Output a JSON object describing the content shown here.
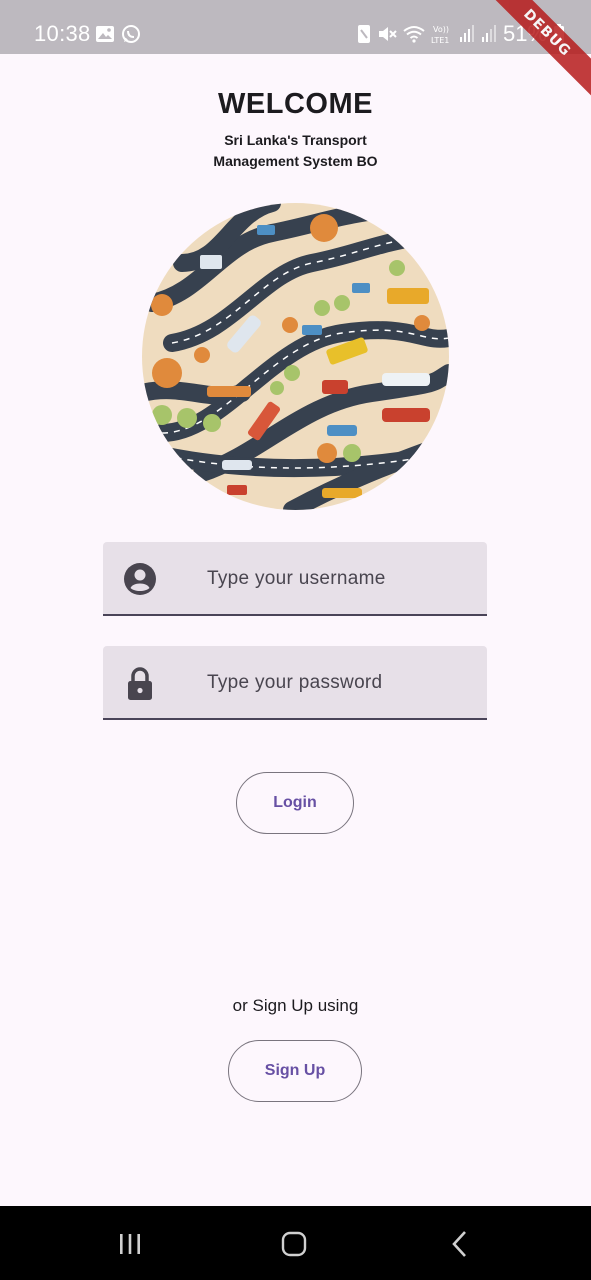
{
  "status_bar": {
    "time": "10:38",
    "battery": "51%",
    "icons": [
      "gallery-icon",
      "whatsapp-icon",
      "nfc-icon",
      "mute-icon",
      "wifi-icon",
      "volte-icon",
      "signal-icon",
      "signal-icon",
      "battery-icon"
    ]
  },
  "debug_banner": "DEBUG",
  "header": {
    "title": "WELCOME",
    "subtitle_line1": "Sri Lanka's Transport",
    "subtitle_line2": "Management System BO"
  },
  "illustration": {
    "description_icon": "transport-map-illustration"
  },
  "form": {
    "username_placeholder": "Type your username",
    "username_value": "",
    "password_placeholder": "Type your password",
    "password_value": "",
    "username_icon": "account-circle-icon",
    "password_icon": "lock-icon"
  },
  "buttons": {
    "login": "Login",
    "signup": "Sign Up"
  },
  "signup_prompt": "or Sign Up using",
  "navigation": {
    "recent": "recent-apps-icon",
    "home": "home-icon",
    "back": "back-icon"
  },
  "colors": {
    "background": "#fdf7fd",
    "field_fill": "#e7e0e8",
    "accent": "#6750a4",
    "outline": "#79747e"
  }
}
